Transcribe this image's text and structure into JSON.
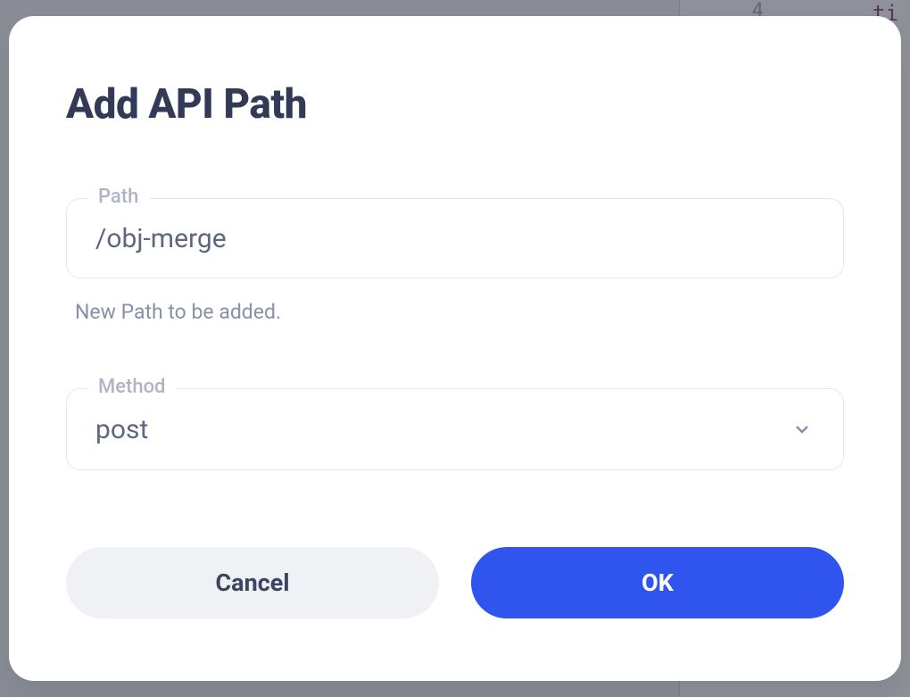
{
  "background": {
    "line_number": "4",
    "code_fragment": "ti\ne\nn\nt\nv\ns"
  },
  "modal": {
    "title": "Add API Path",
    "path": {
      "label": "Path",
      "value": "/obj-merge",
      "helper": "New Path to be added."
    },
    "method": {
      "label": "Method",
      "value": "post"
    },
    "buttons": {
      "cancel": "Cancel",
      "ok": "OK"
    }
  }
}
